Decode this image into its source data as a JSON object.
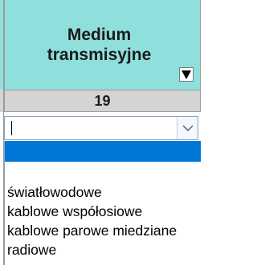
{
  "header": {
    "title": "Medium\ntransmisyjne",
    "filter_icon": "dropdown-arrow-icon"
  },
  "value_row": {
    "value": "19"
  },
  "combo": {
    "value": "",
    "dropdown_icon": "chevron-down-icon"
  },
  "dropdown": {
    "items": [
      {
        "label": "",
        "selected": true
      },
      {
        "label": "",
        "selected": false
      },
      {
        "label": "światłowodowe",
        "selected": false
      },
      {
        "label": "kablowe współosiowe",
        "selected": false
      },
      {
        "label": "kablowe parowe miedziane",
        "selected": false
      },
      {
        "label": "radiowe",
        "selected": false
      }
    ]
  },
  "colors": {
    "header_bg": "#8fe0dc",
    "value_row_bg": "#d4d4d4",
    "selection": "#0078d7",
    "combo_border": "#8aa3bd"
  }
}
